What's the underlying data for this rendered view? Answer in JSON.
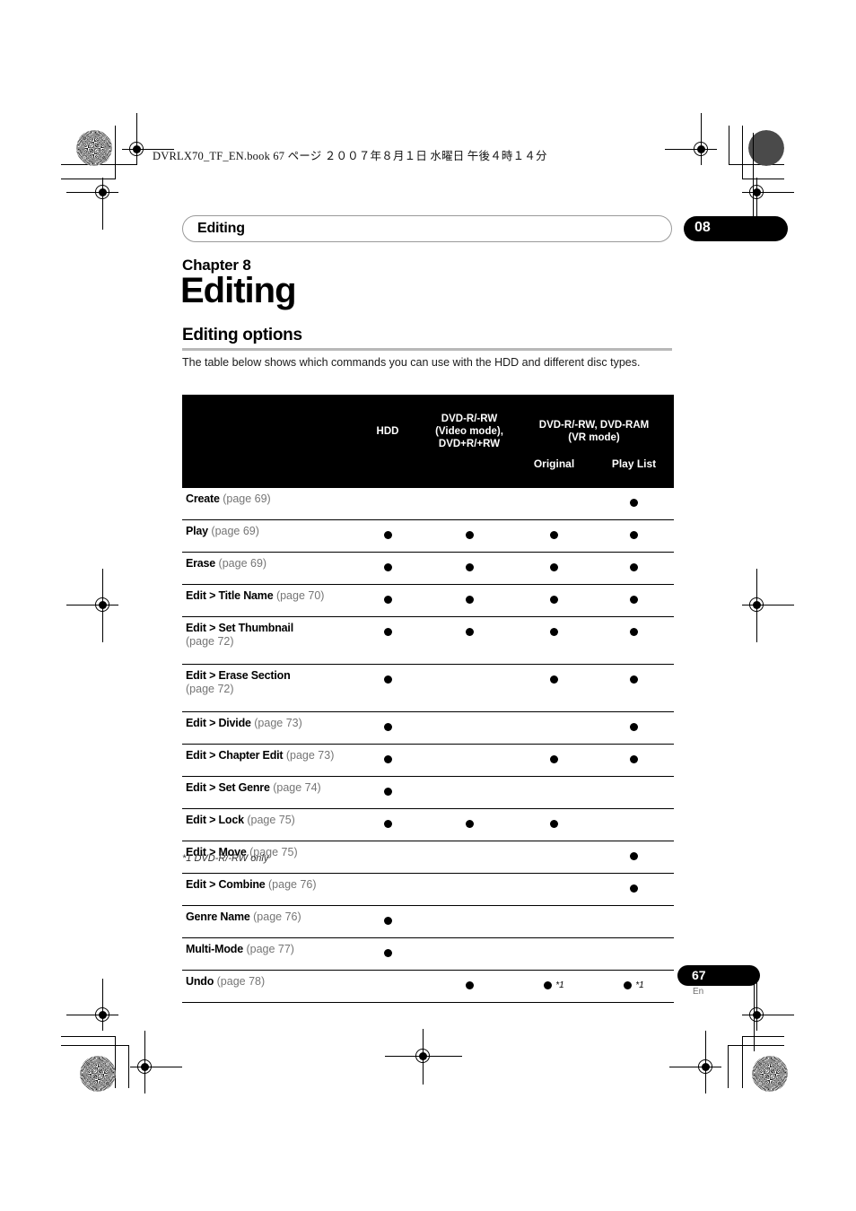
{
  "print_header": {
    "text": "DVRLX70_TF_EN.book  67 ページ  ２００７年８月１日  水曜日  午後４時１４分"
  },
  "running_head": {
    "title": "Editing",
    "chapter_tab": "08"
  },
  "chapter": {
    "label": "Chapter 8",
    "title": "Editing"
  },
  "section": {
    "title": "Editing options",
    "intro": "The table below shows which commands you can use with the HDD and different disc types."
  },
  "table": {
    "headers": {
      "name": "",
      "hdd": "HDD",
      "video_mode": "DVD-R/-RW\n(Video mode),\nDVD+R/+RW",
      "vr_group": "DVD-R/-RW, DVD-RAM\n(VR mode)",
      "vr_original": "Original",
      "vr_playlist": "Play List"
    },
    "header_lines": {
      "video_mode_l1": "DVD-R/-RW",
      "video_mode_l2": "(Video mode),",
      "video_mode_l3": "DVD+R/+RW",
      "vr_l1": "DVD-R/-RW, DVD-RAM",
      "vr_l2": "(VR mode)"
    },
    "rows": [
      {
        "name": "Create",
        "page": "(page 69)",
        "hdd": "",
        "video": "",
        "original": "",
        "playlist": "dot",
        "tall": false
      },
      {
        "name": "Play",
        "page": "(page 69)",
        "hdd": "dot",
        "video": "dot",
        "original": "dot",
        "playlist": "dot",
        "tall": false
      },
      {
        "name": "Erase",
        "page": "(page 69)",
        "hdd": "dot",
        "video": "dot",
        "original": "dot",
        "playlist": "dot",
        "tall": false
      },
      {
        "name": "Edit > Title Name",
        "page": "(page 70)",
        "hdd": "dot",
        "video": "dot",
        "original": "dot",
        "playlist": "dot",
        "tall": false
      },
      {
        "name": "Edit > Set Thumbnail",
        "page": "(page 72)",
        "hdd": "dot",
        "video": "dot",
        "original": "dot",
        "playlist": "dot",
        "tall": true
      },
      {
        "name": "Edit > Erase Section",
        "page": "(page 72)",
        "hdd": "dot",
        "video": "",
        "original": "dot",
        "playlist": "dot",
        "tall": true
      },
      {
        "name": "Edit > Divide",
        "page": "(page 73)",
        "hdd": "dot",
        "video": "",
        "original": "",
        "playlist": "dot",
        "tall": false
      },
      {
        "name": "Edit > Chapter Edit",
        "page": "(page 73)",
        "hdd": "dot",
        "video": "",
        "original": "dot",
        "playlist": "dot",
        "tall": false
      },
      {
        "name": "Edit > Set Genre",
        "page": "(page 74)",
        "hdd": "dot",
        "video": "",
        "original": "",
        "playlist": "",
        "tall": false
      },
      {
        "name": "Edit > Lock",
        "page": "(page 75)",
        "hdd": "dot",
        "video": "dot",
        "original": "dot",
        "playlist": "",
        "tall": false
      },
      {
        "name": "Edit > Move",
        "page": "(page 75)",
        "hdd": "",
        "video": "",
        "original": "",
        "playlist": "dot",
        "tall": false
      },
      {
        "name": "Edit > Combine",
        "page": "(page 76)",
        "hdd": "",
        "video": "",
        "original": "",
        "playlist": "dot",
        "tall": false
      },
      {
        "name": "Genre Name",
        "page": "(page 76)",
        "hdd": "dot",
        "video": "",
        "original": "",
        "playlist": "",
        "tall": false
      },
      {
        "name": "Multi-Mode",
        "page": "(page 77)",
        "hdd": "dot",
        "video": "",
        "original": "",
        "playlist": "",
        "tall": false
      },
      {
        "name": "Undo",
        "page": "(page 78)",
        "hdd": "",
        "video": "dot",
        "original": "dot*1",
        "playlist": "dot*1",
        "tall": false
      }
    ],
    "footnote": "*1 DVD-R/-RW only",
    "footnote_marker": "*1"
  },
  "footer": {
    "page_number": "67",
    "language": "En"
  },
  "colors": {
    "header_band": "#000000",
    "rule": "#b8b8b8",
    "page_ref": "#757575"
  }
}
